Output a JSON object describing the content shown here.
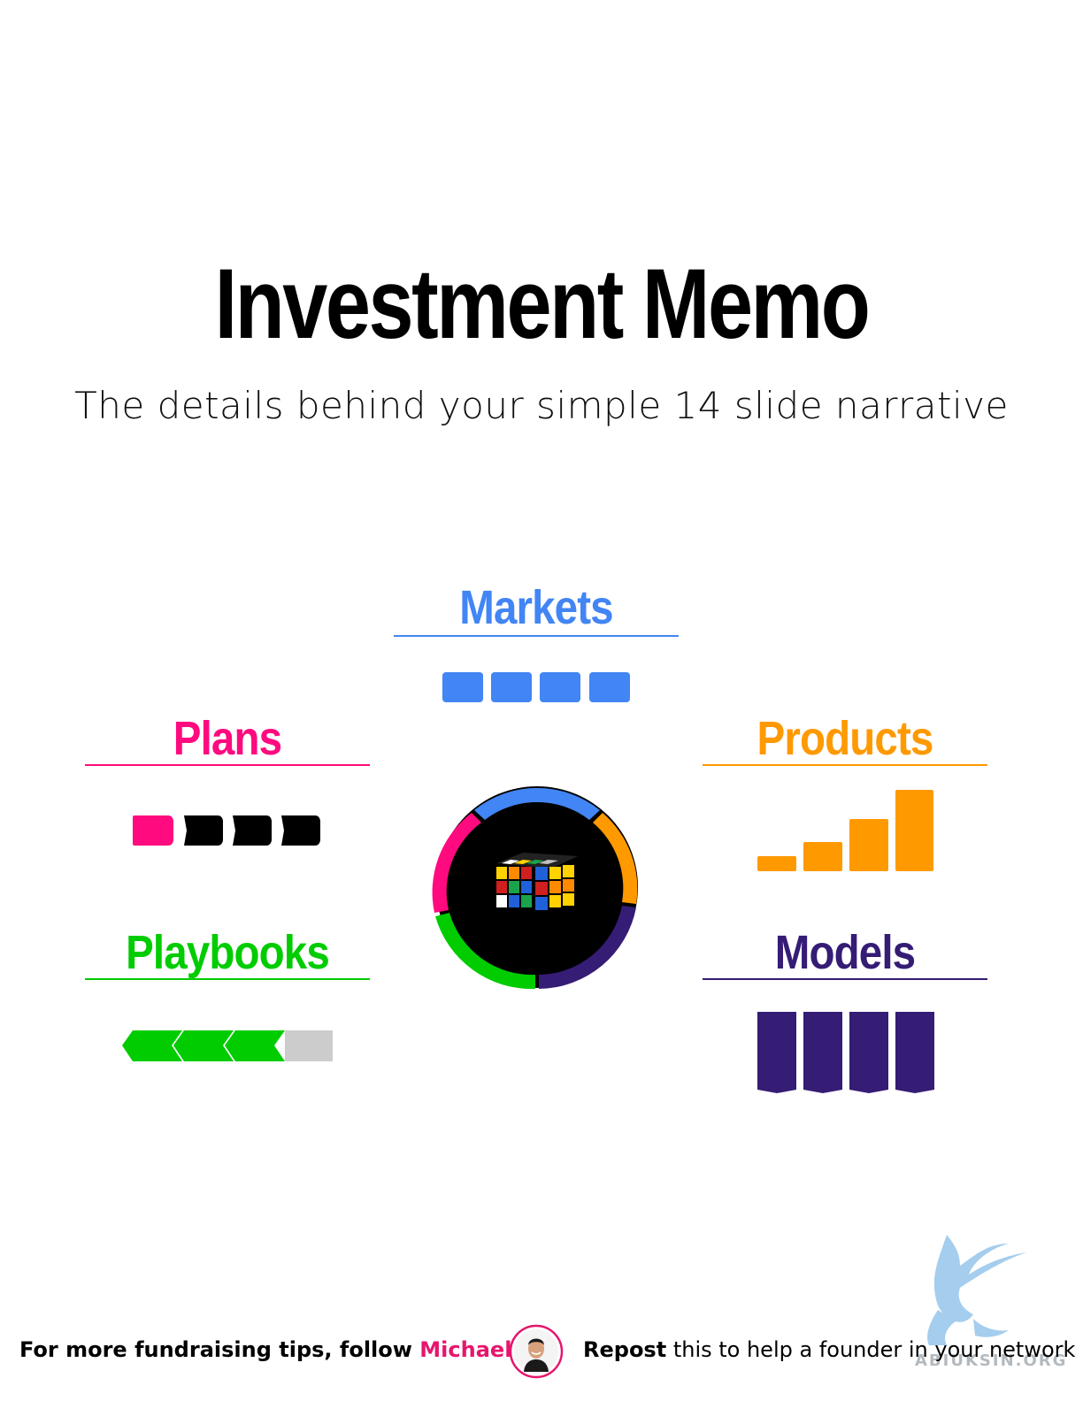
{
  "title": "Investment Memo",
  "subtitle": "The details behind your simple 14 slide narrative",
  "sections": {
    "markets": {
      "label": "Markets",
      "color": "#4285f4"
    },
    "plans": {
      "label": "Plans",
      "color": "#ff0a7f"
    },
    "products": {
      "label": "Products",
      "color": "#ff9900"
    },
    "playbooks": {
      "label": "Playbooks",
      "color": "#00cc00"
    },
    "models": {
      "label": "Models",
      "color": "#351c75"
    }
  },
  "center_ring": {
    "segments": [
      "blue",
      "orange",
      "indigo",
      "green",
      "pink"
    ],
    "icon": "rubiks-cube-icon"
  },
  "footer": {
    "prefix": "For more fundraising tips, follow ",
    "author": "Michael Ho",
    "author_color": "#e6166e",
    "repost_bold": "Repost",
    "repost_rest": " this to help a founder in your network"
  },
  "watermark": {
    "icon": "griffin-icon",
    "text": "ABIUKSIN.ORG"
  }
}
